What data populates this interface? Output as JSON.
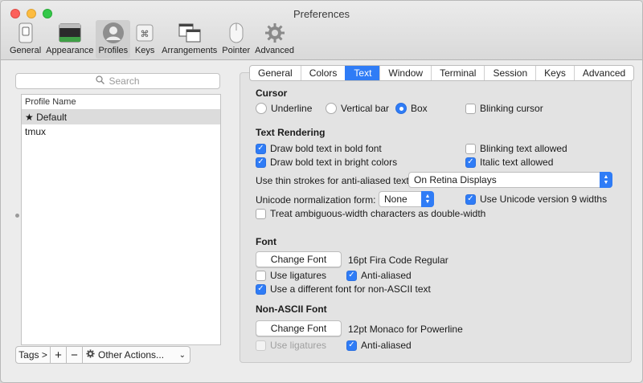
{
  "window": {
    "title": "Preferences"
  },
  "toolbar": {
    "items": [
      {
        "label": "General",
        "icon": "switch-icon"
      },
      {
        "label": "Appearance",
        "icon": "window-icon"
      },
      {
        "label": "Profiles",
        "icon": "person-icon",
        "selected": true
      },
      {
        "label": "Keys",
        "icon": "keyboard-icon"
      },
      {
        "label": "Arrangements",
        "icon": "arrangements-icon"
      },
      {
        "label": "Pointer",
        "icon": "mouse-icon"
      },
      {
        "label": "Advanced",
        "icon": "gear-icon"
      }
    ]
  },
  "sidebar": {
    "search_placeholder": "Search",
    "list_header": "Profile Name",
    "profiles": [
      {
        "name": "★ Default",
        "selected": true
      },
      {
        "name": "tmux",
        "selected": false
      }
    ],
    "bottom": {
      "tags_label": "Tags >",
      "add_label": "+",
      "remove_label": "−",
      "actions_label": "Other Actions..."
    }
  },
  "tabs": [
    {
      "label": "General"
    },
    {
      "label": "Colors"
    },
    {
      "label": "Text",
      "active": true
    },
    {
      "label": "Window"
    },
    {
      "label": "Terminal"
    },
    {
      "label": "Session"
    },
    {
      "label": "Keys"
    },
    {
      "label": "Advanced"
    }
  ],
  "cursor": {
    "title": "Cursor",
    "underline_label": "Underline",
    "vertical_bar_label": "Vertical bar",
    "box_label": "Box",
    "selected": "Box",
    "blinking_label": "Blinking cursor",
    "blinking": false
  },
  "text_rendering": {
    "title": "Text Rendering",
    "bold_font_label": "Draw bold text in bold font",
    "bold_font": true,
    "bright_colors_label": "Draw bold text in bright colors",
    "bright_colors": true,
    "blinking_text_label": "Blinking text allowed",
    "blinking_text": false,
    "italic_label": "Italic text allowed",
    "italic": true,
    "thin_strokes_label": "Use thin strokes for anti-aliased text",
    "thin_strokes_value": "On Retina Displays",
    "normalization_label": "Unicode normalization form:",
    "normalization_value": "None",
    "unicode9_label": "Use Unicode version 9 widths",
    "unicode9": true,
    "ambiguous_label": "Treat ambiguous-width characters as double-width",
    "ambiguous": false
  },
  "font": {
    "title": "Font",
    "change_font_label": "Change Font",
    "font_desc": "16pt Fira Code Regular",
    "ligatures_label": "Use ligatures",
    "ligatures": false,
    "anti_aliased_label": "Anti-aliased",
    "anti_aliased": true,
    "non_ascii_label": "Use a different font for non-ASCII text",
    "non_ascii": true
  },
  "non_ascii_font": {
    "title": "Non-ASCII Font",
    "change_font_label": "Change Font",
    "font_desc": "12pt Monaco for Powerline",
    "ligatures_label": "Use ligatures",
    "ligatures": false,
    "anti_aliased_label": "Anti-aliased",
    "anti_aliased": true
  },
  "colors": {
    "accent": "#2f7cf6",
    "close": "#fc605b",
    "minimize": "#fdbc40",
    "zoom": "#34c84a"
  }
}
